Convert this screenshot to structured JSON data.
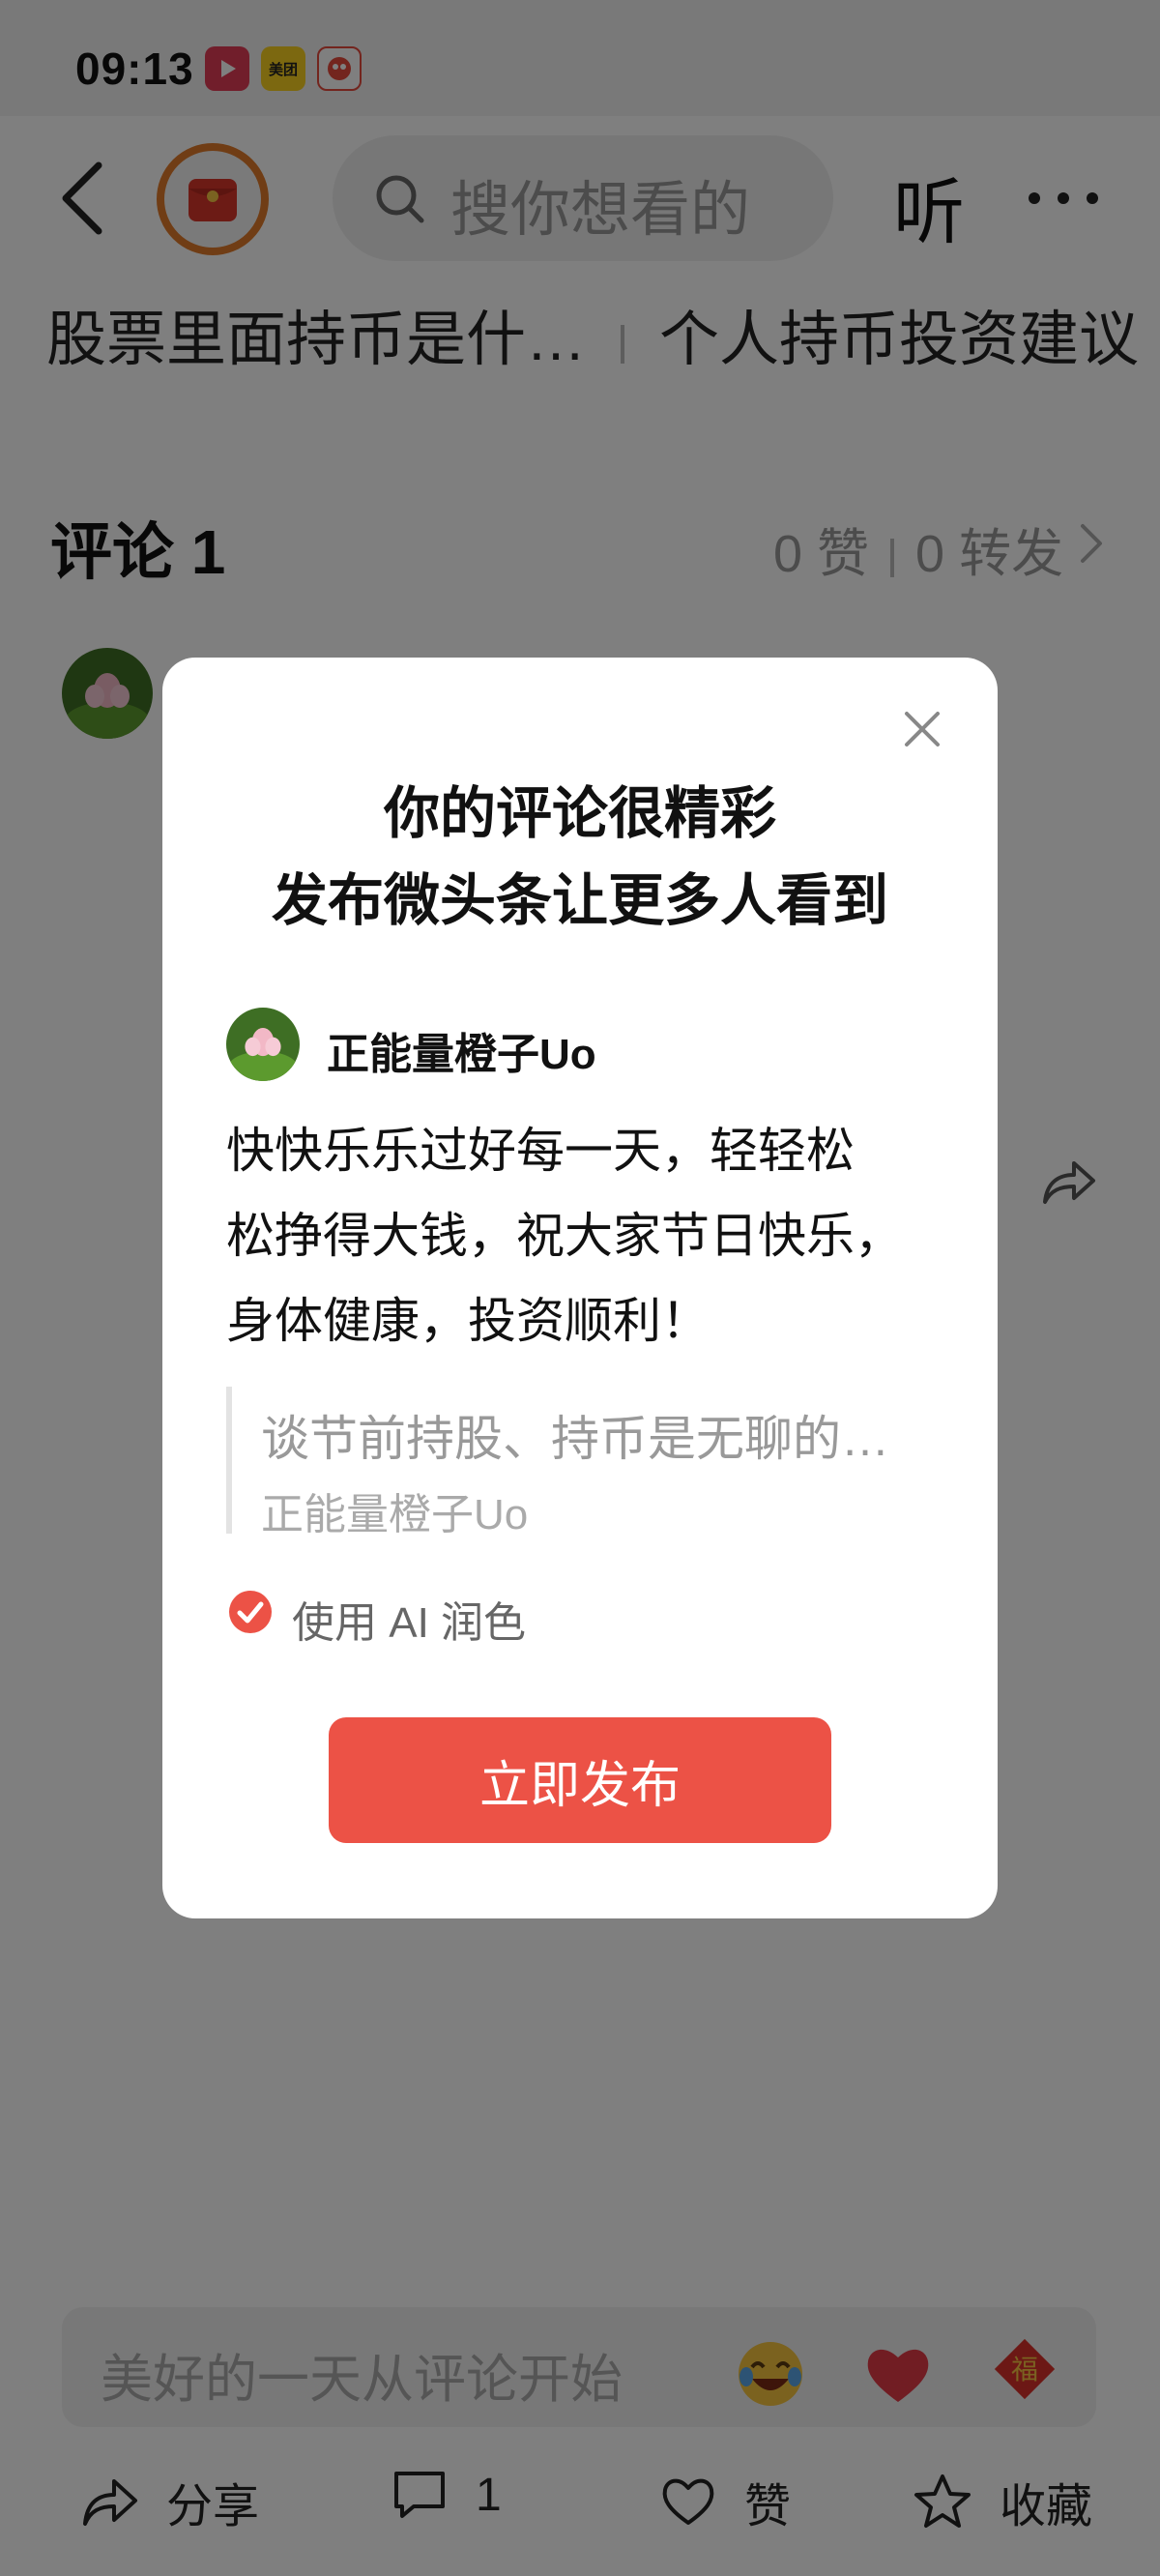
{
  "status_bar": {
    "time": "09:13",
    "apps": [
      {
        "name": "video-app-icon",
        "color": "#e23c56"
      },
      {
        "name": "meituan-icon",
        "label": "美团",
        "color": "#f9d020"
      },
      {
        "name": "mascot-app-icon",
        "color": "#e74a3c"
      }
    ]
  },
  "nav": {
    "search_placeholder": "搜你想看的",
    "listen_label": "听"
  },
  "related": {
    "item1": "股票里面持币是什…",
    "item2": "个人持币投资建议"
  },
  "comments": {
    "title": "评论 1",
    "likes": "0 赞",
    "reposts": "0 转发"
  },
  "comment_input": {
    "placeholder": "美好的一天从评论开始"
  },
  "bottom_bar": {
    "share_label": "分享",
    "comment_count": "1",
    "like_label": "赞",
    "favorite_label": "收藏"
  },
  "modal": {
    "title_line1": "你的评论很精彩",
    "title_line2": "发布微头条让更多人看到",
    "username": "正能量橙子Uo",
    "body_line1": "快快乐乐过好每一天，轻轻松",
    "body_line2": "松挣得大钱，祝大家节日快乐，",
    "body_line3": "身体健康，投资顺利！",
    "quote_text": "谈节前持股、持币是无聊的…",
    "quote_author": "正能量橙子Uo",
    "ai_polish_label": "使用 AI 润色",
    "ai_polish_checked": true,
    "publish_button": "立即发布"
  },
  "colors": {
    "accent": "#ec5246",
    "overlay": "rgba(0,0,0,0.5)"
  }
}
